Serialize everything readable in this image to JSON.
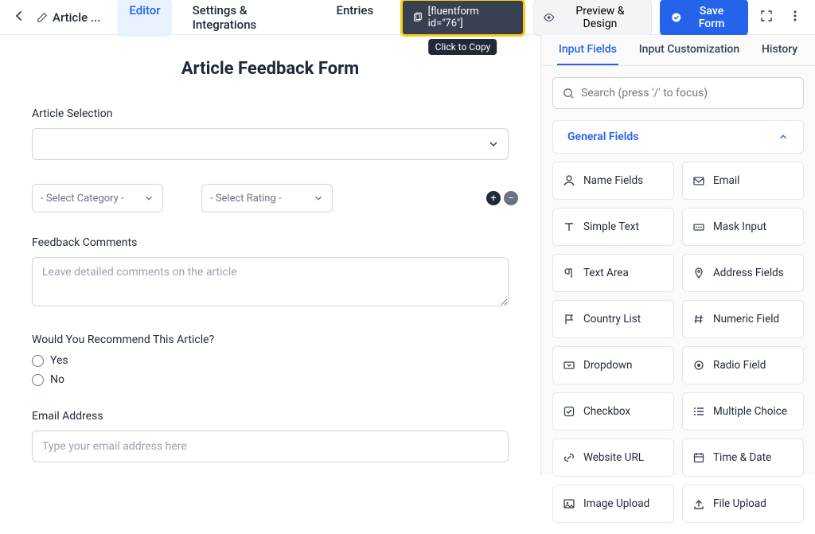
{
  "header": {
    "title_short": "Article ...",
    "nav": {
      "editor": "Editor",
      "settings": "Settings & Integrations",
      "entries": "Entries"
    },
    "shortcode": "[fluentform id=\"76\"]",
    "tooltip": "Click to Copy",
    "preview": "Preview & Design",
    "save": "Save Form"
  },
  "form": {
    "title": "Article Feedback Form",
    "article_selection_label": "Article Selection",
    "select_category": "- Select Category -",
    "select_rating": "- Select Rating -",
    "feedback_label": "Feedback Comments",
    "feedback_placeholder": "Leave detailed comments on the article",
    "recommend_label": "Would You Recommend This Article?",
    "recommend_yes": "Yes",
    "recommend_no": "No",
    "email_label": "Email Address",
    "email_placeholder": "Type your email address here"
  },
  "sidebar": {
    "tabs": {
      "input_fields": "Input Fields",
      "customization": "Input Customization",
      "history": "History"
    },
    "search_placeholder": "Search (press '/' to focus)",
    "accordion": "General Fields",
    "fields": [
      {
        "icon": "user",
        "label": "Name Fields"
      },
      {
        "icon": "mail",
        "label": "Email"
      },
      {
        "icon": "text",
        "label": "Simple Text"
      },
      {
        "icon": "mask",
        "label": "Mask Input"
      },
      {
        "icon": "para",
        "label": "Text Area"
      },
      {
        "icon": "pin",
        "label": "Address Fields"
      },
      {
        "icon": "flag",
        "label": "Country List"
      },
      {
        "icon": "hash",
        "label": "Numeric Field"
      },
      {
        "icon": "drop",
        "label": "Dropdown"
      },
      {
        "icon": "radio",
        "label": "Radio Field"
      },
      {
        "icon": "check",
        "label": "Checkbox"
      },
      {
        "icon": "list",
        "label": "Multiple Choice"
      },
      {
        "icon": "link",
        "label": "Website URL"
      },
      {
        "icon": "cal",
        "label": "Time & Date"
      },
      {
        "icon": "imgup",
        "label": "Image Upload"
      },
      {
        "icon": "fileup",
        "label": "File Upload"
      }
    ]
  }
}
